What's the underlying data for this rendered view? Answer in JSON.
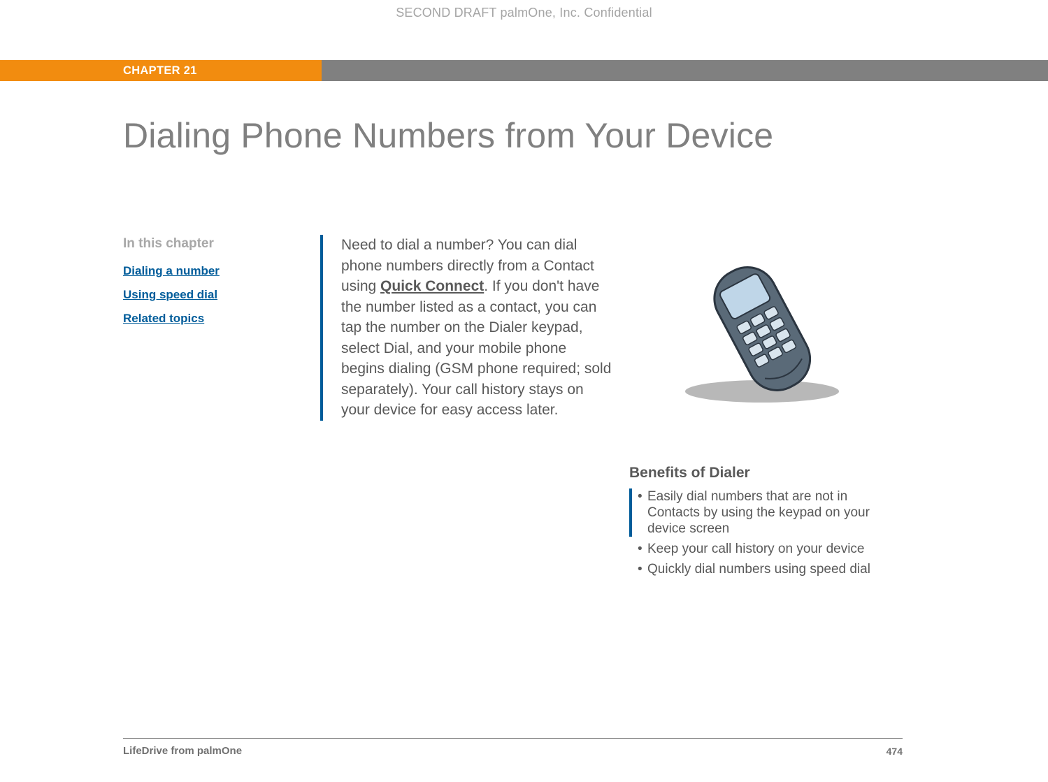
{
  "header": {
    "watermark": "SECOND DRAFT palmOne, Inc.  Confidential",
    "chapter_label": "CHAPTER 21"
  },
  "title": "Dialing Phone Numbers from Your Device",
  "sidebar": {
    "heading": "In this chapter",
    "links": [
      "Dialing a number",
      "Using speed dial",
      "Related topics"
    ]
  },
  "intro": {
    "pre": "Need to dial a number? You can dial phone numbers directly from a Contact using ",
    "link": "Quick Connect",
    "post": ". If you don't have the number listed as a contact, you can tap the number on the Dialer keypad, select Dial, and your mobile phone begins dialing (GSM phone required; sold separately). Your call history stays on your device for easy access later."
  },
  "benefits": {
    "heading": "Benefits of Dialer",
    "items": [
      "Easily dial numbers that are not in Contacts by using the keypad on your device screen",
      "Keep your call history on your device",
      "Quickly dial numbers using speed dial"
    ]
  },
  "footer": {
    "left": "LifeDrive from palmOne",
    "page": "474"
  }
}
